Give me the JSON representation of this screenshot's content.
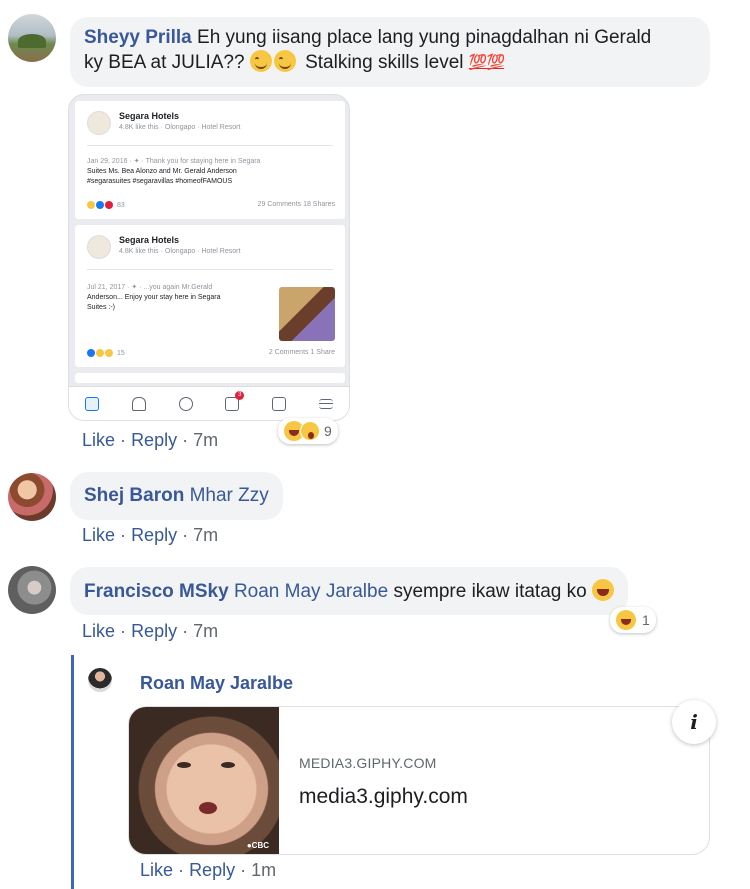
{
  "comments": [
    {
      "author": "Sheyy Prilla",
      "text_line1": "Eh yung iisang place lang yung pinagdalhan ni Gerald",
      "text_line2": "ky BEA at JULIA??",
      "text_tail": "Stalking skills level",
      "emoji_tail": "💯💯",
      "like": "Like",
      "reply": "Reply",
      "time": "7m",
      "reaction_count": "9"
    },
    {
      "author": "Shej Baron",
      "tag": "Mhar Zzy",
      "like": "Like",
      "reply": "Reply",
      "time": "7m"
    },
    {
      "author": "Francisco MSky",
      "tag": "Roan May Jaralbe",
      "text": "syempre ikaw itatag ko",
      "like": "Like",
      "reply": "Reply",
      "time": "7m",
      "reaction_count": "1"
    }
  ],
  "reply": {
    "author": "Roan May Jaralbe",
    "link_domain": "MEDIA3.GIPHY.COM",
    "link_title": "media3.giphy.com",
    "info_icon": "i",
    "gif_watermark": "●CBC",
    "like": "Like",
    "reply": "Reply",
    "time": "1m"
  },
  "embedded_screenshot": {
    "posts": [
      {
        "page": "Segara Hotels",
        "sub": "4.8K like this · Olongapo · Hotel Resort",
        "date": "Jan 29, 2016 · ✦ · Thank you for staying here in Segara",
        "body_line2": "Suites Ms. Bea Alonzo and Mr. Gerald Anderson",
        "body_line3": "#segarasuites #segaravillas #homeofFAMOUS",
        "reactions": "83",
        "stats": "29 Comments   18 Shares"
      },
      {
        "page": "Segara Hotels",
        "sub": "4.8K like this · Olongapo · Hotel Resort",
        "date": "Jul 21, 2017 · ✦ · ...you again Mr.Gerald",
        "body_line2": "Anderson... Enjoy your stay here in Segara",
        "body_line3": "Suites :-)",
        "reactions": "15",
        "stats": "2 Comments   1 Share"
      }
    ],
    "badge": "3"
  },
  "separator": "·",
  "colors": {
    "link": "#385898",
    "bubble": "#f2f3f5",
    "thread": "#4267b2",
    "meta": "#606770"
  }
}
